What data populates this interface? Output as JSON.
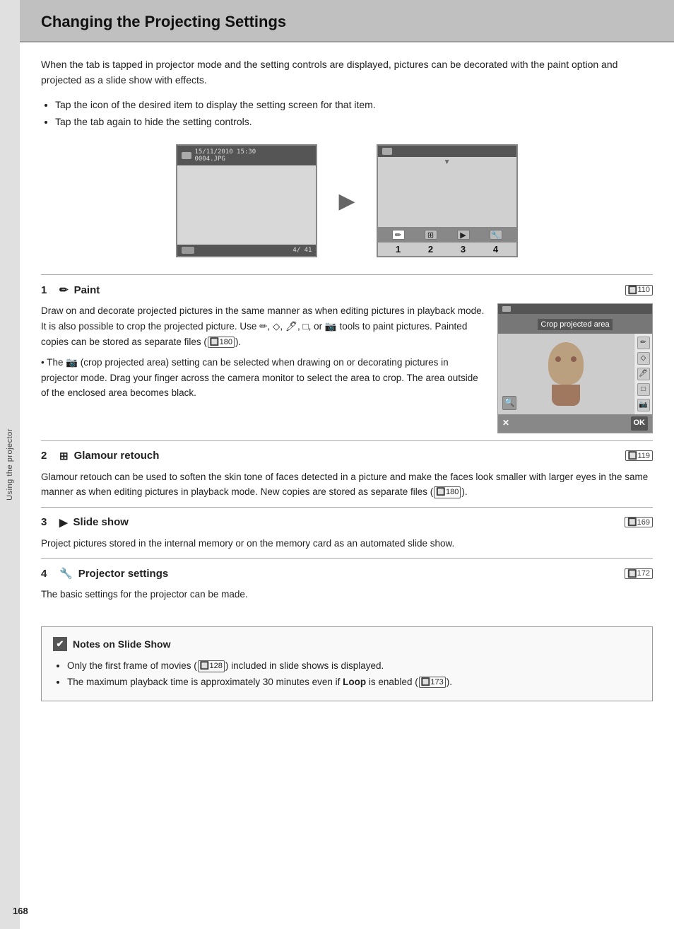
{
  "page": {
    "title": "Changing the Projecting Settings",
    "sidebar_text": "Using the projector",
    "page_number": "168"
  },
  "intro": {
    "paragraph": "When the tab is tapped in projector mode and the setting controls are displayed, pictures can be decorated with the paint option and projected as a slide show with effects.",
    "bullets": [
      "Tap the icon of the desired item to display the setting screen for that item.",
      "Tap the tab again to hide the setting controls."
    ]
  },
  "diagram": {
    "camera_screen": {
      "time": "15/11/2010 15:30",
      "filename": "0004.JPG",
      "counter": "4/ 41"
    },
    "arrow": "▶",
    "projector_labels": [
      "1",
      "2",
      "3",
      "4"
    ]
  },
  "sections": [
    {
      "num": "1",
      "icon": "✏",
      "title": "Paint",
      "ref": "110",
      "body_paragraphs": [
        "Draw on and decorate projected pictures in the same manner as when editing pictures in playback mode. It is also possible to crop the projected picture. Use ✏, ◇, 🖊, □, or 📷 tools to paint pictures. Painted copies can be stored as separate files (🔲 180).",
        "• The 📷 (crop projected area) setting can be selected when drawing on or decorating pictures in projector mode. Drag your finger across the camera monitor to select the area to crop. The area outside of the enclosed area becomes black."
      ],
      "crop_image": {
        "title": "Crop projected area",
        "has_image": true
      }
    },
    {
      "num": "2",
      "icon": "⊞",
      "title": "Glamour retouch",
      "ref": "119",
      "body": "Glamour retouch can be used to soften the skin tone of faces detected in a picture and make the faces look smaller with larger eyes in the same manner as when editing pictures in playback mode. New copies are stored as separate files (🔲 180)."
    },
    {
      "num": "3",
      "icon": "▶",
      "title": "Slide show",
      "ref": "169",
      "body": "Project pictures stored in the internal memory or on the memory card as an automated slide show."
    },
    {
      "num": "4",
      "icon": "🔧",
      "title": "Projector settings",
      "ref": "172",
      "body": "The basic settings for the projector can be made."
    }
  ],
  "notes": {
    "title": "Notes on Slide Show",
    "bullets": [
      "Only the first frame of movies (🔲 128) included in slide shows is displayed.",
      "The maximum playback time is approximately 30 minutes even if Loop is enabled (🔲 173)."
    ]
  },
  "refs": {
    "r110": "110",
    "r119": "119",
    "r169": "169",
    "r172": "172",
    "r128": "128",
    "r173": "173",
    "r180a": "180",
    "r180b": "180"
  }
}
